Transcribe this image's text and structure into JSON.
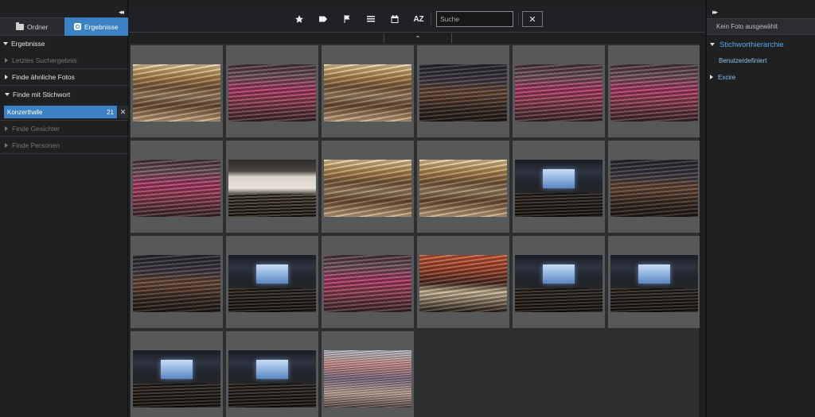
{
  "left_panel": {
    "collapse_glyph": "◂◂",
    "tabs": [
      {
        "label": "Ordner",
        "icon": "folder-icon",
        "active": false
      },
      {
        "label": "Ergebnisse",
        "icon": "search-icon",
        "active": true
      }
    ],
    "section_title": "Ergebnisse",
    "items": {
      "last_result": "Letztes Suchergebnis",
      "similar": "Finde ähnliche Fotos",
      "keyword": "Finde mit Stichwort",
      "faces": "Finde Gesichter",
      "persons": "Finde Personen"
    },
    "keyword_chip": {
      "label": "Konzerthalle",
      "count": "21",
      "remove_glyph": "✕"
    }
  },
  "toolbar": {
    "icons": [
      "star-icon",
      "tag-icon",
      "flag-icon",
      "list-icon",
      "calendar-icon",
      "sort-az-icon"
    ],
    "sort_label": "AZ",
    "search_placeholder": "Suche",
    "clear_glyph": "✕",
    "handle_glyph": "⌃"
  },
  "grid": {
    "photos": [
      {
        "style": "a"
      },
      {
        "style": "b"
      },
      {
        "style": "a"
      },
      {
        "style": "c"
      },
      {
        "style": "b"
      },
      {
        "style": "b"
      },
      {
        "style": "b"
      },
      {
        "style": "e"
      },
      {
        "style": "a"
      },
      {
        "style": "a"
      },
      {
        "style": "d"
      },
      {
        "style": "c"
      },
      {
        "style": "c"
      },
      {
        "style": "d"
      },
      {
        "style": "b"
      },
      {
        "style": "f"
      },
      {
        "style": "d"
      },
      {
        "style": "d"
      },
      {
        "style": "d"
      },
      {
        "style": "d"
      },
      {
        "style": "g"
      }
    ]
  },
  "right_panel": {
    "expand_glyph": "▸▸",
    "no_photo": "Kein Foto ausgewählt",
    "hierarchy_title": "Stichworthierarchie",
    "user_defined": "Benutzerdefiniert",
    "excire": "Excire"
  },
  "colors": {
    "accent": "#3a82c4",
    "link": "#5aa8e6"
  }
}
